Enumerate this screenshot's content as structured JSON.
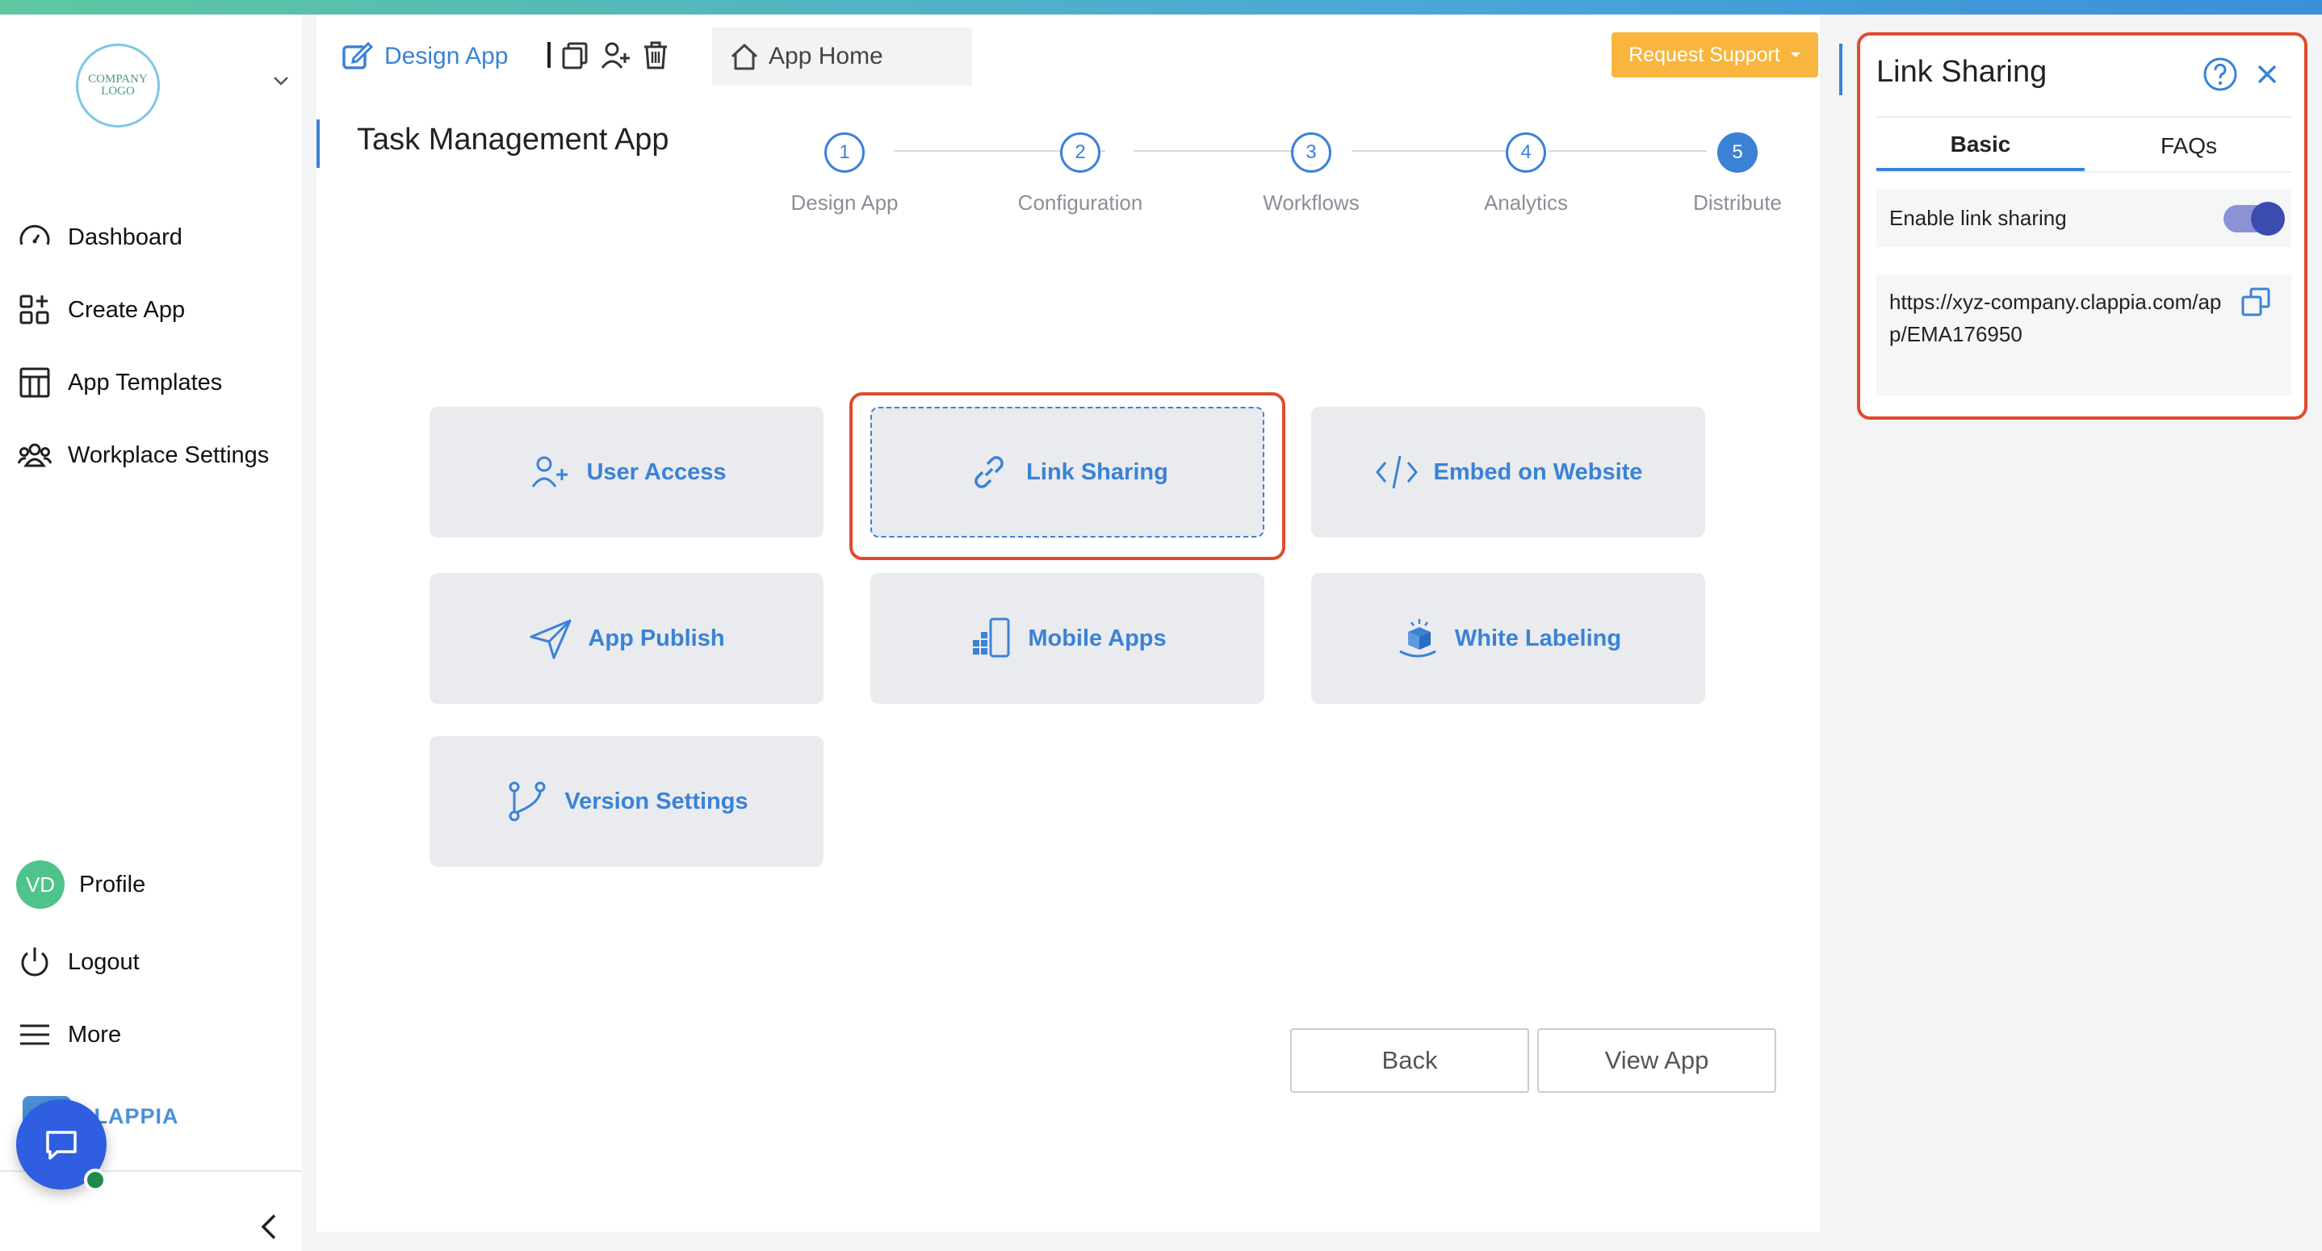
{
  "sidebar": {
    "logo_text": "COMPANY LOGO",
    "nav": [
      {
        "label": "Dashboard",
        "icon": "gauge-icon"
      },
      {
        "label": "Create App",
        "icon": "grid-plus-icon"
      },
      {
        "label": "App Templates",
        "icon": "template-icon"
      },
      {
        "label": "Workplace Settings",
        "icon": "users-icon"
      }
    ],
    "profile_initials": "VD",
    "profile_label": "Profile",
    "logout_label": "Logout",
    "more_label": "More",
    "brand_text": "CLAPPIA"
  },
  "header": {
    "design_tab": "Design App",
    "home_tab": "App Home",
    "request_support": "Request Support",
    "app_title": "Task Management App"
  },
  "stepper": [
    {
      "num": "1",
      "label": "Design App"
    },
    {
      "num": "2",
      "label": "Configuration"
    },
    {
      "num": "3",
      "label": "Workflows"
    },
    {
      "num": "4",
      "label": "Analytics"
    },
    {
      "num": "5",
      "label": "Distribute"
    }
  ],
  "cards": {
    "user_access": "User Access",
    "link_sharing": "Link Sharing",
    "embed": "Embed on Website",
    "app_publish": "App Publish",
    "mobile_apps": "Mobile Apps",
    "white_labeling": "White Labeling",
    "version_settings": "Version Settings"
  },
  "footer": {
    "back": "Back",
    "view_app": "View App"
  },
  "panel": {
    "title": "Link Sharing",
    "tabs": [
      "Basic",
      "FAQs"
    ],
    "active_tab": "Basic",
    "toggle_label": "Enable link sharing",
    "toggle_on": true,
    "url": "https://xyz-company.clappia.com/app/EMA176950"
  },
  "colors": {
    "accent": "#3b82d6",
    "highlight": "#e04b2e",
    "support": "#f8b63e"
  }
}
